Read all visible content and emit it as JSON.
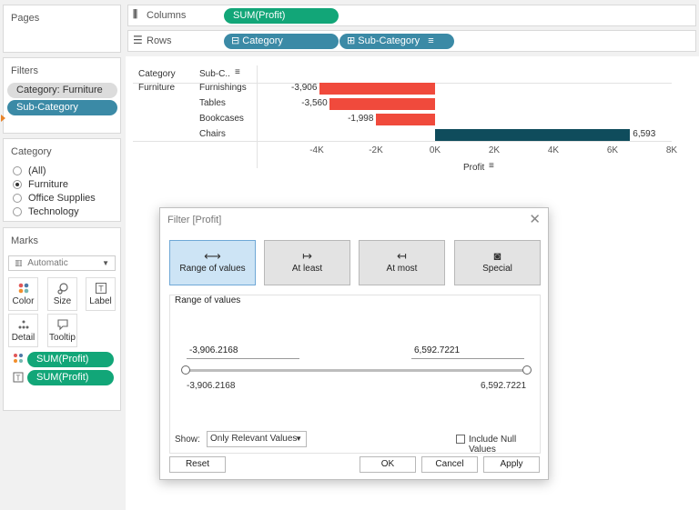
{
  "left": {
    "pages_title": "Pages",
    "filters_title": "Filters",
    "filters": [
      "Category: Furniture",
      "Sub-Category"
    ],
    "category_card": {
      "title": "Category",
      "options": [
        "(All)",
        "Furniture",
        "Office Supplies",
        "Technology"
      ],
      "selected": 1
    },
    "marks": {
      "title": "Marks",
      "type": "Automatic",
      "buttons": [
        "Color",
        "Size",
        "Label",
        "Detail",
        "Tooltip"
      ],
      "pills": [
        "SUM(Profit)",
        "SUM(Profit)"
      ]
    }
  },
  "shelves": {
    "columns_label": "Columns",
    "columns_pill": "SUM(Profit)",
    "rows_label": "Rows",
    "rows_pills": [
      "Category",
      "Sub-Category"
    ]
  },
  "chart_data": {
    "type": "bar",
    "orientation": "horizontal",
    "header_category": "Category",
    "header_subcategory": "Sub-C..",
    "category": "Furniture",
    "categories": [
      "Furnishings",
      "Tables",
      "Bookcases",
      "Chairs"
    ],
    "values": [
      -3906,
      -3560,
      -1998,
      6593
    ],
    "value_labels": [
      "-3,906",
      "-3,560",
      "-1,998",
      "6,593"
    ],
    "colors": [
      "#f04a3c",
      "#f04a3c",
      "#f04a3c",
      "#0f4c5c"
    ],
    "xlim": [
      -6000,
      8000
    ],
    "ticks": [
      -4000,
      -2000,
      0,
      2000,
      4000,
      6000,
      8000
    ],
    "tick_labels": [
      "-4K",
      "-2K",
      "0K",
      "2K",
      "4K",
      "6K",
      "8K"
    ],
    "xlabel": "Profit"
  },
  "dialog": {
    "title": "Filter [Profit]",
    "tabs": [
      "Range of values",
      "At least",
      "At most",
      "Special"
    ],
    "active_tab": 0,
    "section_title": "Range of values",
    "min_value": "-3,906.2168",
    "max_value": "6,592.7221",
    "min_label": "-3,906.2168",
    "max_label": "6,592.7221",
    "show_label": "Show:",
    "show_value": "Only Relevant Values",
    "include_null_label": "Include Null Values",
    "reset_label": "Reset",
    "ok_label": "OK",
    "cancel_label": "Cancel",
    "apply_label": "Apply"
  }
}
